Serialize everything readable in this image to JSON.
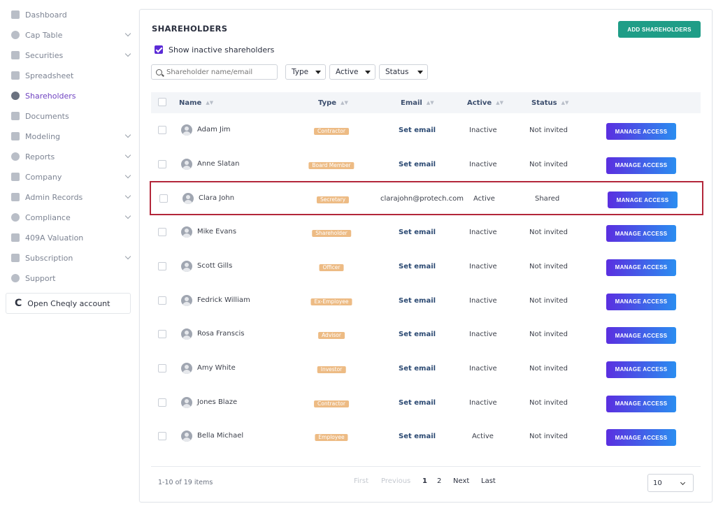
{
  "sidebar": {
    "items": [
      {
        "label": "Dashboard",
        "icon": "dashboard-icon",
        "expandable": false
      },
      {
        "label": "Cap Table",
        "icon": "pie-chart-icon",
        "expandable": true
      },
      {
        "label": "Securities",
        "icon": "clipboard-icon",
        "expandable": true
      },
      {
        "label": "Spreadsheet",
        "icon": "spreadsheet-icon",
        "expandable": false
      },
      {
        "label": "Shareholders",
        "icon": "user-icon",
        "expandable": false,
        "active": true
      },
      {
        "label": "Documents",
        "icon": "folder-icon",
        "expandable": false
      },
      {
        "label": "Modeling",
        "icon": "bulb-icon",
        "expandable": true
      },
      {
        "label": "Reports",
        "icon": "report-icon",
        "expandable": true
      },
      {
        "label": "Company",
        "icon": "building-icon",
        "expandable": true
      },
      {
        "label": "Admin Records",
        "icon": "records-icon",
        "expandable": true
      },
      {
        "label": "Compliance",
        "icon": "shield-icon",
        "expandable": true
      },
      {
        "label": "409A Valuation",
        "icon": "bar-chart-icon",
        "expandable": false
      },
      {
        "label": "Subscription",
        "icon": "dollar-icon",
        "expandable": true
      },
      {
        "label": "Support",
        "icon": "support-icon",
        "expandable": false
      }
    ],
    "open_account_label": "Open Cheqly account",
    "open_account_icon": "C"
  },
  "main": {
    "title": "SHAREHOLDERS",
    "add_button": "ADD SHAREHOLDERS",
    "show_inactive_label": "Show inactive shareholders",
    "show_inactive_checked": true,
    "search_placeholder": "Shareholder name/email",
    "filters": {
      "type": "Type",
      "active": "Active",
      "status": "Status"
    },
    "columns": {
      "name": "Name",
      "type": "Type",
      "email": "Email",
      "active": "Active",
      "status": "Status"
    },
    "rows": [
      {
        "name": "Adam Jim",
        "type": "Contractor",
        "email": "Set email",
        "email_set": false,
        "active": "Inactive",
        "status": "Not invited",
        "action": "MANAGE ACCESS"
      },
      {
        "name": "Anne Slatan",
        "type": "Board Member",
        "email": "Set email",
        "email_set": false,
        "active": "Inactive",
        "status": "Not invited",
        "action": "MANAGE ACCESS"
      },
      {
        "name": "Clara John",
        "type": "Secretary",
        "email": "clarajohn@protech.com",
        "email_set": true,
        "active": "Active",
        "status": "Shared",
        "action": "MANAGE ACCESS",
        "highlighted": true
      },
      {
        "name": "Mike Evans",
        "type": "Shareholder",
        "email": "Set email",
        "email_set": false,
        "active": "Inactive",
        "status": "Not invited",
        "action": "MANAGE ACCESS"
      },
      {
        "name": "Scott Gills",
        "type": "Officer",
        "email": "Set email",
        "email_set": false,
        "active": "Inactive",
        "status": "Not invited",
        "action": "MANAGE ACCESS"
      },
      {
        "name": "Fedrick William",
        "type": "Ex-Employee",
        "email": "Set email",
        "email_set": false,
        "active": "Inactive",
        "status": "Not invited",
        "action": "MANAGE ACCESS"
      },
      {
        "name": "Rosa Franscis",
        "type": "Advisor",
        "email": "Set email",
        "email_set": false,
        "active": "Inactive",
        "status": "Not invited",
        "action": "MANAGE ACCESS"
      },
      {
        "name": "Amy White",
        "type": "Investor",
        "email": "Set email",
        "email_set": false,
        "active": "Inactive",
        "status": "Not invited",
        "action": "MANAGE ACCESS"
      },
      {
        "name": "Jones Blaze",
        "type": "Contractor",
        "email": "Set email",
        "email_set": false,
        "active": "Inactive",
        "status": "Not invited",
        "action": "MANAGE ACCESS"
      },
      {
        "name": "Bella Michael",
        "type": "Employee",
        "email": "Set email",
        "email_set": false,
        "active": "Active",
        "status": "Not invited",
        "action": "MANAGE ACCESS"
      }
    ],
    "pagination": {
      "summary": "1-10 of 19 items",
      "first": "First",
      "previous": "Previous",
      "pages": [
        "1",
        "2"
      ],
      "current_page": "1",
      "next": "Next",
      "last": "Last",
      "per_page": "10"
    }
  },
  "colors": {
    "accent_purple": "#6f42c1",
    "add_button": "#1f9d87",
    "type_badge": "#edbb84",
    "highlight_border": "#b3263a"
  }
}
